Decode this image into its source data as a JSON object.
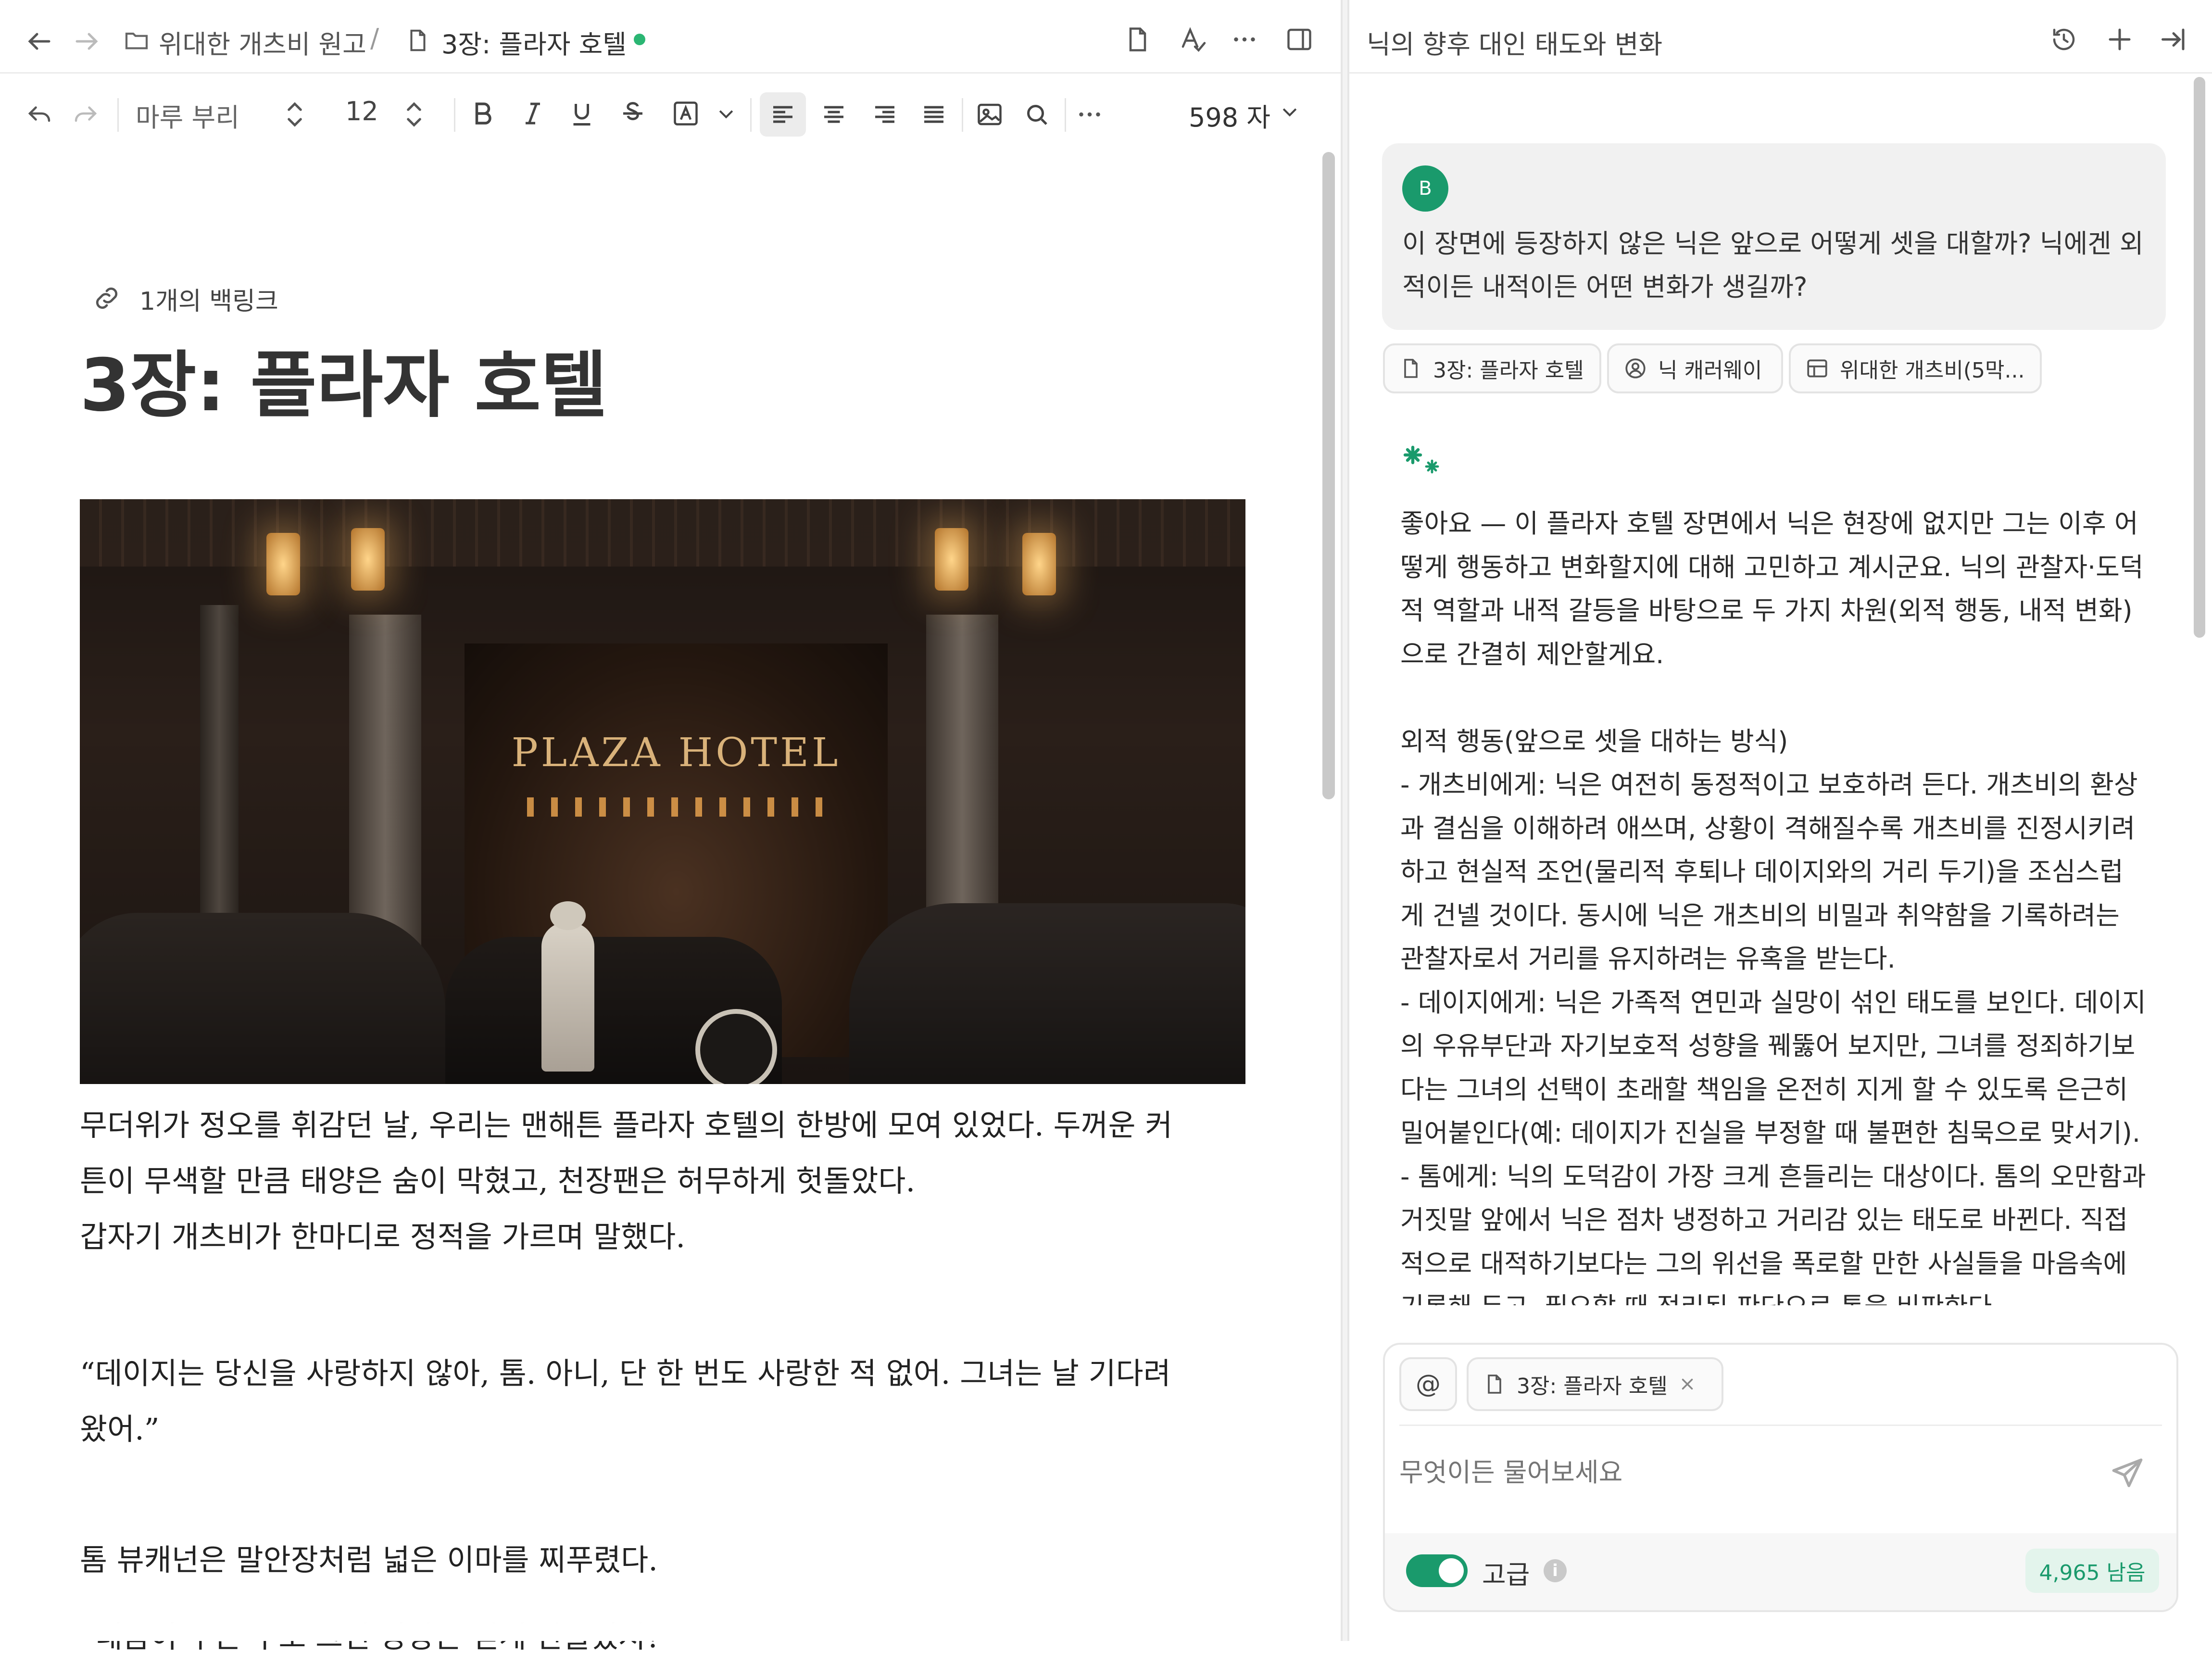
{
  "editor": {
    "breadcrumb": {
      "folder": "위대한 개츠비 원고",
      "separator": "/",
      "document": "3장: 플라자 호텔"
    },
    "toolbar": {
      "font": "마루 부리",
      "size": "12",
      "word_count": "598 자"
    },
    "backlinks": "1개의 백링크",
    "title": "3장: 플라자 호텔",
    "image_sign": "PLAZA HOTEL",
    "paragraphs": [
      "무더위가 정오를 휘감던 날, 우리는 맨해튼 플라자 호텔의 한방에 모여 있었다. 두꺼운 커",
      "튼이 무색할 만큼 태양은 숨이 막혔고, 천장팬은 허무하게 헛돌았다.",
      "갑자기 개츠비가 한마디로 정적을 가르며 말했다.",
      "“데이지는 당신을 사랑하지 않아, 톰. 아니, 단 한 번도 사랑한 적 없어. 그녀는 날 기다려",
      "왔어.”",
      "톰 뷰캐넌은 말안장처럼 넓은 이마를 찌푸렸다.",
      "“네놈이 무슨 수로 그런 망상은 믿게 만들었지?”"
    ]
  },
  "assistant": {
    "title": "닉의 향후 대인 태도와 변화",
    "user_avatar": "B",
    "question_lines": [
      "이 장면에 등장하지 않은 닉은 앞으로 어떻게 셋을 대할까? 닉에겐 외",
      "적이든 내적이든 어떤 변화가 생길까?"
    ],
    "context_chips": [
      "3장: 플라자 호텔",
      "닉 캐러웨이",
      "위대한 개츠비(5막..."
    ],
    "answer_lines": [
      "좋아요 — 이 플라자 호텔 장면에서 닉은 현장에 없지만 그는 이후 어",
      "떻게 행동하고 변화할지에 대해 고민하고 계시군요. 닉의 관찰자·도덕",
      "적 역할과 내적 갈등을 바탕으로 두 가지 차원(외적 행동, 내적 변화)",
      "으로 간결히 제안할게요.",
      "",
      "외적 행동(앞으로 셋을 대하는 방식)",
      "- 개츠비에게: 닉은 여전히 동정적이고 보호하려 든다. 개츠비의 환상",
      "과 결심을 이해하려 애쓰며, 상황이 격해질수록 개츠비를 진정시키려",
      "하고 현실적 조언(물리적 후퇴나 데이지와의 거리 두기)을 조심스럽",
      "게 건넬 것이다. 동시에 닉은 개츠비의 비밀과 취약함을 기록하려는",
      "관찰자로서 거리를 유지하려는 유혹을 받는다.",
      "- 데이지에게: 닉은 가족적 연민과 실망이 섞인 태도를 보인다. 데이지",
      "의 우유부단과 자기보호적 성향을 꿰뚫어 보지만, 그녀를 정죄하기보",
      "다는 그녀의 선택이 초래할 책임을 온전히 지게 할 수 있도록 은근히",
      "밀어붙인다(예: 데이지가 진실을 부정할 때 불편한 침묵으로 맞서기).",
      "- 톰에게: 닉의 도덕감이 가장 크게 흔들리는 대상이다. 톰의 오만함과",
      "거짓말 앞에서 닉은 점차 냉정하고 거리감 있는 태도로 바뀐다. 직접",
      "적으로 대적하기보다는 그의 위선을 폭로할 만한 사실들을 마음속에",
      "기록해 두고, 필요할 때 정리된 판단으로 톰을 비판한다."
    ],
    "composer": {
      "at_symbol": "@",
      "attached_chip": "3장: 플라자 호텔",
      "placeholder": "무엇이든 물어보세요",
      "toggle_label": "고급",
      "toggle_on": true,
      "remaining": "4,965 남음"
    }
  },
  "colors": {
    "accent_green": "#1a9a6c",
    "status_dot": "#2bb673"
  }
}
